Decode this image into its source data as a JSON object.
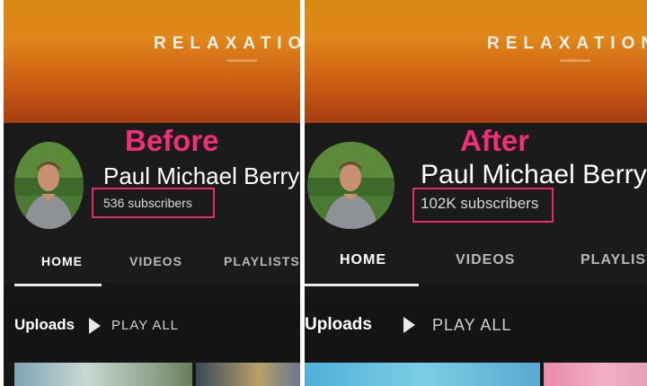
{
  "banner_text": "RELAXATION",
  "before": {
    "tag": "Before",
    "channel_name": "Paul Michael Berry",
    "subscribers": "536 subscribers",
    "tabs": [
      "HOME",
      "VIDEOS",
      "PLAYLISTS"
    ],
    "active_tab": "HOME",
    "uploads_label": "Uploads",
    "play_all_label": "PLAY ALL"
  },
  "after": {
    "tag": "After",
    "channel_name": "Paul Michael Berry",
    "subscribers": "102K subscribers",
    "tabs": [
      "HOME",
      "VIDEOS",
      "PLAYLIST"
    ],
    "active_tab": "HOME",
    "uploads_label": "Uploads",
    "play_all_label": "PLAY ALL"
  },
  "colors": {
    "highlight": "#e8286d",
    "tag_text": "#ef2f7a",
    "banner_top": "#d68a12",
    "banner_bottom": "#a83e12",
    "header_bg": "#1b1b1b"
  },
  "icons": [
    "avatar-photo",
    "play-icon"
  ]
}
